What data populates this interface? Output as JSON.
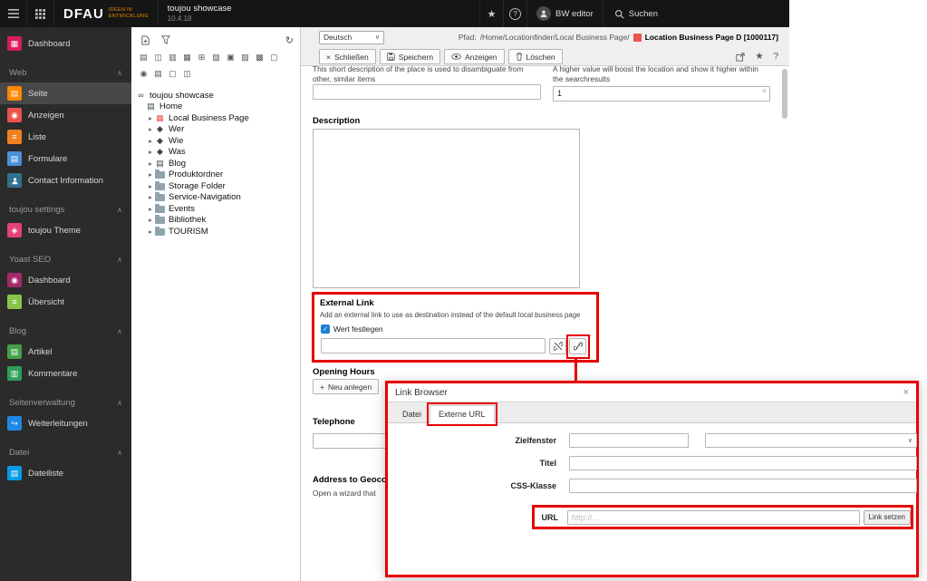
{
  "colors": {
    "annotation": "#e60000",
    "accent_orange": "#ff8700",
    "topbar_bg": "#151515",
    "sidebar_bg": "#2b2b2b",
    "checkbox_blue": "#1a7fd4"
  },
  "icons": {
    "star": "★",
    "help": "?",
    "close": "×",
    "caret_down": "∨",
    "chevron_up": "∧",
    "expander": "▸",
    "refresh": "↻",
    "plus": "+",
    "clear": "×",
    "check": "✓"
  },
  "topbar": {
    "logo": "DFAU",
    "logo_tagline_line1": "IDEEN IN",
    "logo_tagline_line2": "ENTWICKLUNG",
    "site_name": "toujou showcase",
    "version": "10.4.18",
    "user_name": "BW editor",
    "search_label": "Suchen"
  },
  "sidebar": {
    "items": [
      {
        "label": "Dashboard",
        "type": "module",
        "glyph": "▦",
        "color": "#d81b60"
      },
      {
        "label": "Web",
        "type": "section"
      },
      {
        "label": "Seite",
        "type": "module",
        "glyph": "▤",
        "color": "#ff8700",
        "active": true
      },
      {
        "label": "Anzeigen",
        "type": "module",
        "glyph": "◉",
        "color": "#e8544d"
      },
      {
        "label": "Liste",
        "type": "module",
        "glyph": "≡",
        "color": "#f0811f"
      },
      {
        "label": "Formulare",
        "type": "module",
        "glyph": "▤",
        "color": "#4a90d9"
      },
      {
        "label": "Contact Information",
        "type": "module",
        "glyph": "",
        "color": "#31708f"
      },
      {
        "label": "toujou settings",
        "type": "section"
      },
      {
        "label": "toujou Theme",
        "type": "module",
        "glyph": "◈",
        "color": "#e4407b"
      },
      {
        "label": "Yoast SEO",
        "type": "section"
      },
      {
        "label": "Dashboard",
        "type": "module",
        "glyph": "◉",
        "color": "#a4286a"
      },
      {
        "label": "Übersicht",
        "type": "module",
        "glyph": "≡",
        "color": "#8bc34a"
      },
      {
        "label": "Blog",
        "type": "section"
      },
      {
        "label": "Artikel",
        "type": "module",
        "glyph": "▤",
        "color": "#43a047"
      },
      {
        "label": "Kommentare",
        "type": "module",
        "glyph": "▥",
        "color": "#2e9e5b"
      },
      {
        "label": "Seitenverwaltung",
        "type": "section"
      },
      {
        "label": "Weiterleitungen",
        "type": "module",
        "glyph": "↪",
        "color": "#1e88e5"
      },
      {
        "label": "Datei",
        "type": "section"
      },
      {
        "label": "Dateiliste",
        "type": "module",
        "glyph": "▤",
        "color": "#039be5"
      }
    ]
  },
  "pagetree": {
    "drag_icons_row1": [
      "▤",
      "◫",
      "▥",
      "▦",
      "⊞",
      "▧",
      "▣",
      "▨",
      "▩",
      "▢"
    ],
    "drag_icons_row2": [
      "◉",
      "▤",
      "▢",
      "◫"
    ],
    "items": [
      {
        "label": "toujou showcase",
        "depth": 0,
        "icon": "site-icon",
        "glyph": "∞"
      },
      {
        "label": "Home",
        "depth": 1,
        "icon": "page-icon",
        "glyph": "▤"
      },
      {
        "label": "Local Business Page",
        "depth": 2,
        "icon": "business-page-icon",
        "glyph": "▦",
        "expandable": true
      },
      {
        "label": "Wer",
        "depth": 2,
        "icon": "campaign-icon",
        "glyph": "◆",
        "expandable": true
      },
      {
        "label": "Wie",
        "depth": 2,
        "icon": "campaign-icon",
        "glyph": "◆",
        "expandable": true
      },
      {
        "label": "Was",
        "depth": 2,
        "icon": "campaign-icon",
        "glyph": "◆",
        "expandable": true
      },
      {
        "label": "Blog",
        "depth": 2,
        "icon": "page-icon",
        "glyph": "▤",
        "expandable": true
      },
      {
        "label": "Produktordner",
        "depth": 2,
        "icon": "folder-icon",
        "expandable": true
      },
      {
        "label": "Storage Folder",
        "depth": 2,
        "icon": "folder-icon",
        "expandable": true
      },
      {
        "label": "Service-Navigation",
        "depth": 2,
        "icon": "folder-icon",
        "expandable": true
      },
      {
        "label": "Events",
        "depth": 2,
        "icon": "folder-icon",
        "expandable": true
      },
      {
        "label": "Bibliothek",
        "depth": 2,
        "icon": "folder-icon",
        "expandable": true
      },
      {
        "label": "TOURISM",
        "depth": 2,
        "icon": "folder-icon",
        "expandable": true
      }
    ]
  },
  "docheader": {
    "language_select": "Deutsch",
    "path_label": "Pfad:",
    "path_value": "/Home/Locationfinder/Local Business Page/",
    "record_title": "Location Business Page D [1000117]",
    "close_button": "Schließen",
    "save_button": "Speichern",
    "view_button": "Anzeigen",
    "delete_button": "Löschen"
  },
  "form": {
    "shortdesc_help_line1": "This short description of the place is used to disambiguate from",
    "shortdesc_help_line2": "other, similar items",
    "boost_help_line1": "A higher value will boost the location and show it higher within",
    "boost_help_line2": "the searchresults",
    "boost_value": "1",
    "description_label": "Description",
    "external_link_label": "External Link",
    "external_link_help": "Add an external link to use as destination instead of the default local business page",
    "checkbox_label": "Wert festlegen",
    "opening_hours_label": "Opening Hours",
    "new_record_button": "Neu anlegen",
    "telephone_label": "Telephone",
    "address_label": "Address to Geoco",
    "address_help": "Open a wizard that"
  },
  "link_browser": {
    "title": "Link Browser",
    "tab_file": "Datei",
    "tab_external": "Externe URL",
    "target_label": "Zielfenster",
    "title_label": "Titel",
    "css_label": "CSS-Klasse",
    "url_label": "URL",
    "url_placeholder": "http://...",
    "submit_label": "Link setzen"
  }
}
